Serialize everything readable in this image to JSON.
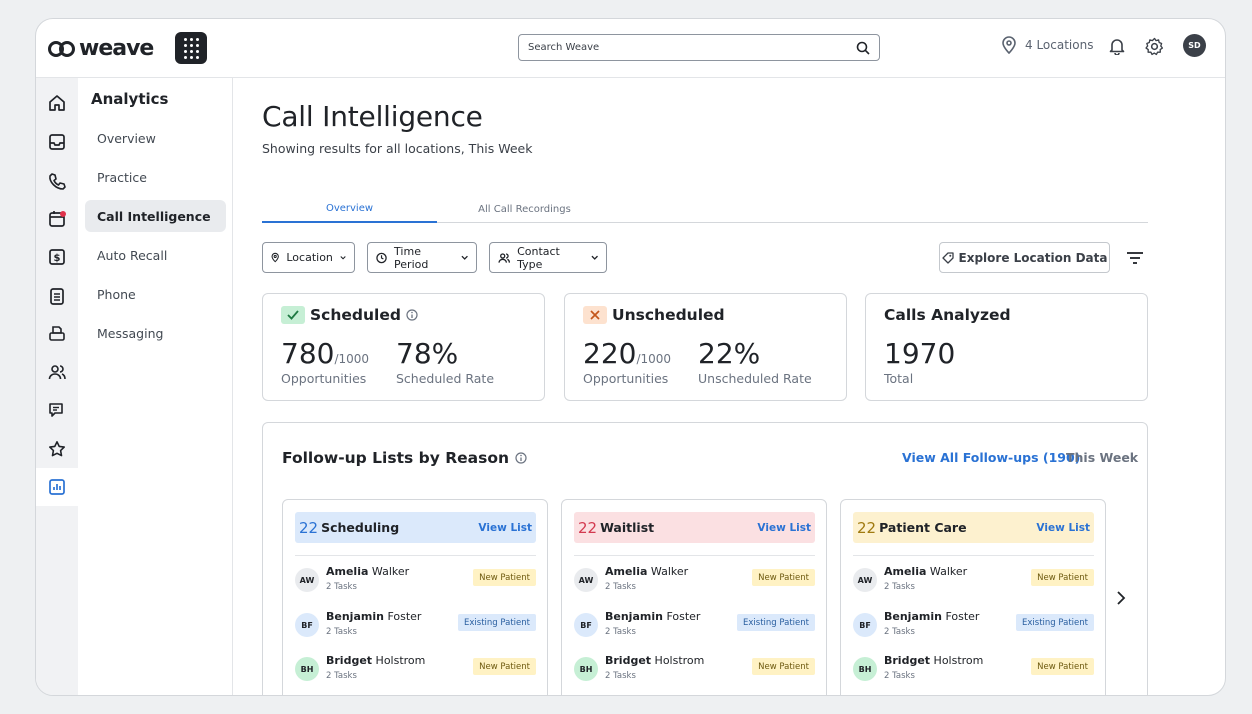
{
  "topbar": {
    "logo_text": "weave",
    "search_placeholder": "Search Weave",
    "locations": "4 Locations",
    "avatar": "SD"
  },
  "sidebar": {
    "title": "Analytics",
    "items": [
      {
        "label": "Overview"
      },
      {
        "label": "Practice"
      },
      {
        "label": "Call Intelligence"
      },
      {
        "label": "Auto Recall"
      },
      {
        "label": "Phone"
      },
      {
        "label": "Messaging"
      }
    ]
  },
  "page": {
    "title": "Call Intelligence",
    "subtitle": "Showing results for all locations, This Week"
  },
  "tabs": [
    {
      "label": "Overview"
    },
    {
      "label": "All Call Recordings"
    }
  ],
  "filters": {
    "location": "Location",
    "time_period": "Time Period",
    "contact_type": "Contact Type",
    "explore": "Explore Location Data"
  },
  "stats": {
    "scheduled": {
      "title": "Scheduled",
      "count": "780",
      "of": "/1000",
      "count_label": "Opportunities",
      "rate": "78%",
      "rate_label": "Scheduled Rate"
    },
    "unscheduled": {
      "title": "Unscheduled",
      "count": "220",
      "of": "/1000",
      "count_label": "Opportunities",
      "rate": "22%",
      "rate_label": "Unscheduled Rate"
    },
    "analyzed": {
      "title": "Calls Analyzed",
      "count": "1970",
      "count_label": "Total"
    }
  },
  "followups": {
    "title": "Follow-up Lists by Reason",
    "view_all": "View All Follow-ups (190)",
    "period": "This Week",
    "lists": [
      {
        "num": "22",
        "title": "Scheduling",
        "view": "View List",
        "color": "#dbe9fb",
        "num_color": "#2a72d4"
      },
      {
        "num": "22",
        "title": "Waitlist",
        "view": "View List",
        "color": "#fbe0e2",
        "num_color": "#d3394f"
      },
      {
        "num": "22",
        "title": "Patient Care",
        "view": "View List",
        "color": "#fdf1cf",
        "num_color": "#a07a10"
      }
    ],
    "people": [
      {
        "initials": "AW",
        "first": "Amelia",
        "last": "Walker",
        "tasks": "2 Tasks",
        "tag": "New Patient"
      },
      {
        "initials": "BF",
        "first": "Benjamin",
        "last": "Foster",
        "tasks": "2 Tasks",
        "tag": "Existing Patient"
      },
      {
        "initials": "BH",
        "first": "Bridget",
        "last": "Holstrom",
        "tasks": "2 Tasks",
        "tag": "New Patient"
      }
    ]
  }
}
